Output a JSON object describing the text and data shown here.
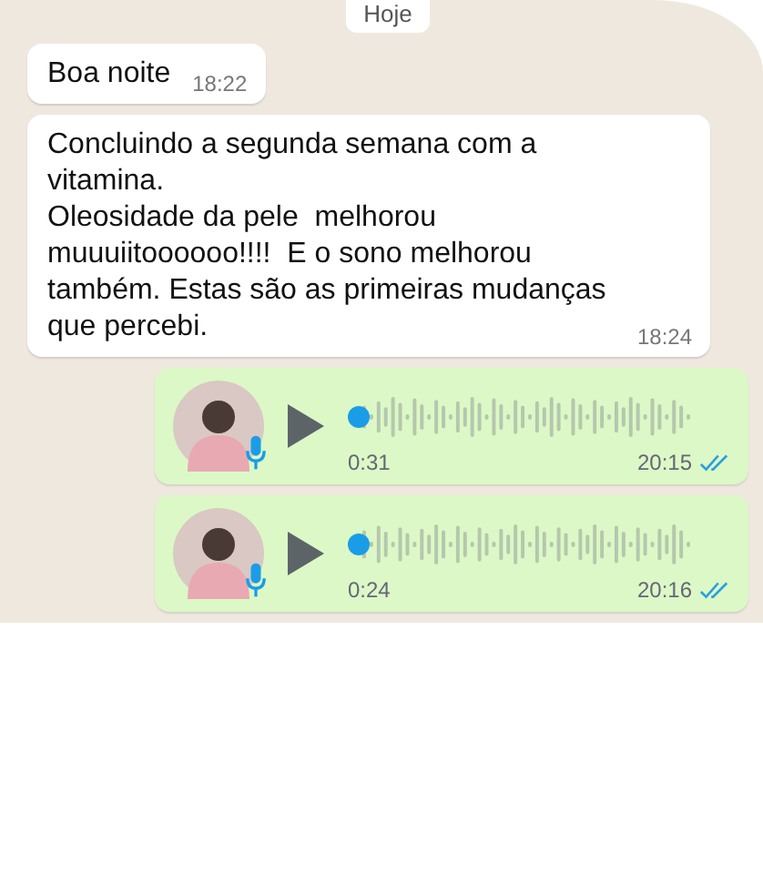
{
  "date_chip": "Hoje",
  "messages": [
    {
      "kind": "text",
      "text": "Boa noite",
      "time": "18:22"
    },
    {
      "kind": "text",
      "text": "Concluindo a segunda semana com a vitamina.\nOleosidade da pele  melhorou muuuiitoooooo!!!!  E o sono melhorou também. Estas são as primeiras mudanças que percebi.",
      "time": "18:24"
    },
    {
      "kind": "voice",
      "duration": "0:31",
      "time": "20:15",
      "read": true
    },
    {
      "kind": "voice",
      "duration": "0:24",
      "time": "20:16",
      "read": true
    }
  ]
}
